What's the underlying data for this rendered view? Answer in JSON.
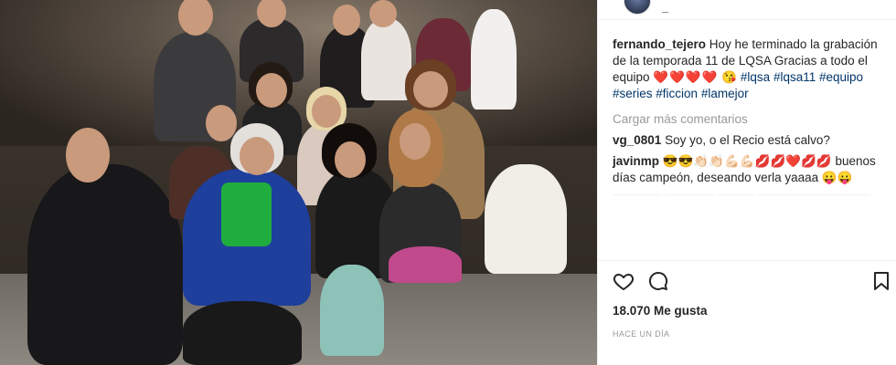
{
  "header": {
    "username_partial": "_"
  },
  "caption": {
    "user": "fernando_tejero",
    "text": "Hoy he terminado la grabación de la temporada 11 de LQSA Gracias a todo el equipo",
    "hearts": "❤️❤️❤️❤️",
    "wink": "😘",
    "hashtags": [
      "#lqsa",
      "#lqsa11",
      "#equipo",
      "#series",
      "#ficcion",
      "#lamejor"
    ]
  },
  "load_more": "Cargar más comentarios",
  "comments": [
    {
      "user": "vg_0801",
      "text": "Soy yo, o el Recio está calvo?"
    },
    {
      "user": "javinmp",
      "emojis": "😎😎👏🏻👏🏻💪🏻💪🏻💋💋❤️💋💋",
      "text": "buenos días campeón, deseando verla yaaaa",
      "tail": "😛😛"
    }
  ],
  "actions": {
    "like_icon": "heart-outline-icon",
    "comment_icon": "comment-bubble-icon",
    "save_icon": "bookmark-icon"
  },
  "likes": "18.070 Me gusta",
  "timestamp": "HACE UN DÍA"
}
